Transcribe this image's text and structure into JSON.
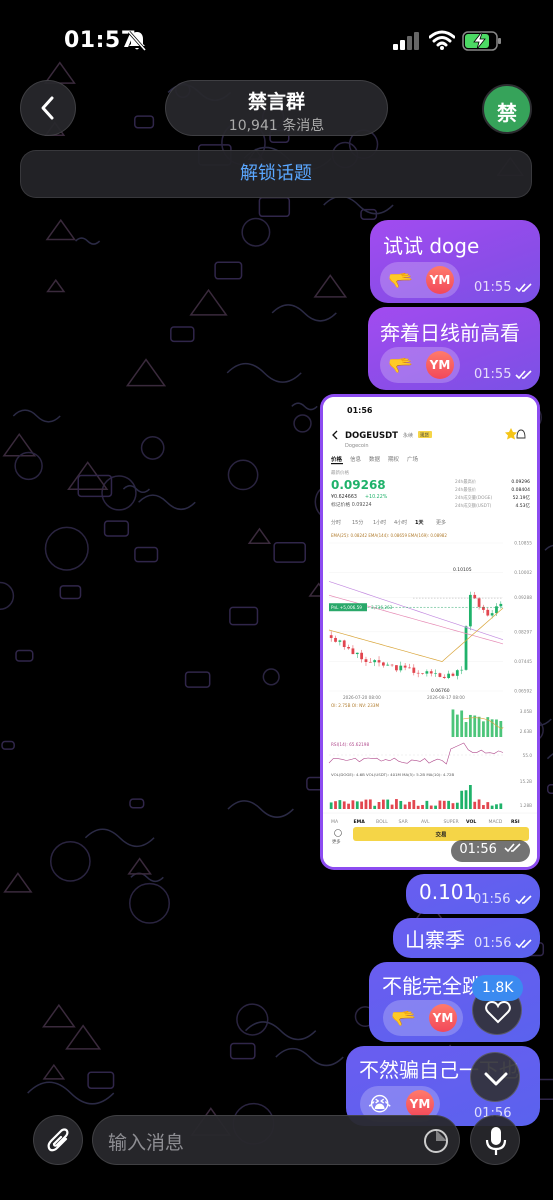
{
  "status_bar": {
    "time": "01:57"
  },
  "header": {
    "title": "禁言群",
    "subtitle": "10,941 条消息",
    "avatar_text": "禁"
  },
  "topic_bar": {
    "label": "解锁话题"
  },
  "colors": {
    "bubble_purple": "#9a4cf0",
    "bubble_blue": "#5f60ee",
    "link_blue": "#5aa7ff",
    "up_green": "#1fb26a",
    "down_red": "#e2464f"
  },
  "messages": [
    {
      "text": "试试 doge",
      "time": "01:55",
      "reaction_emoji": "🫳",
      "reaction_user": "YM"
    },
    {
      "text": "奔着日线前高看",
      "time": "01:55",
      "reaction_emoji": "🫳",
      "reaction_user": "YM"
    },
    {
      "text": "0.101",
      "time": "01:56"
    },
    {
      "text": "山寨季",
      "time": "01:56"
    },
    {
      "text": "不能完全跳完",
      "time": "01:56",
      "reaction_emoji": "🫳",
      "reaction_user": "YM"
    },
    {
      "text": "不然骗自己一下也",
      "time": "01:56",
      "reaction_emoji": "😭",
      "reaction_user": "YM"
    }
  ],
  "screenshot_msg": {
    "time": "01:56",
    "phone_time": "01:56",
    "pair": "DOGEUSDT",
    "perp": "永续",
    "tag": "现货",
    "subtitle": "Dogecoin",
    "tabs": [
      "价格",
      "信息",
      "数据",
      "期权",
      "广场"
    ],
    "last_price_label": "最新价格",
    "price": "0.09268",
    "price_cny": "¥0.624663",
    "change": "+10.22%",
    "mark_price": "标记价格 0.09224",
    "stats": [
      {
        "label": "24h最高价",
        "value": "0.09296"
      },
      {
        "label": "24h最低价",
        "value": "0.08404"
      },
      {
        "label": "24h成交量(DOGE)",
        "value": "52.19亿"
      },
      {
        "label": "24h成交额(USDT)",
        "value": "4.53亿"
      }
    ],
    "intervals": [
      "分时",
      "15分",
      "1小时",
      "4小时",
      "1天",
      "更多"
    ],
    "ema_line": "EMA(25): 0.08242  EMA(144): 0.08659  EMA(169): 0.08982",
    "y_ticks": [
      "0.10855",
      "0.10002",
      "0.09288",
      "0.08297",
      "0.07445",
      "0.06592"
    ],
    "high_label": "0.10105",
    "low_label": "0.06760",
    "pos_label": "PnL +5,006.59",
    "pos_qty": "3,736,263",
    "date_left": "2026-07-20 08:00",
    "date_right": "2026-08-17 08:00",
    "oi_label": "OI: 2.75B  OI: NV: 233M",
    "oi_ticks": [
      "3.05B",
      "2.63B"
    ],
    "rsi_label": "RSI(14): 65.62198",
    "rsi_tick": "55.0",
    "vol_label": "VOL(DOGE): 4.6B  VOL(USDT): 401M  MA(5): 5.2B  MA(10): 4.72B",
    "vol_ticks": [
      "15.2B",
      "1.28B"
    ],
    "indicators": [
      "MA",
      "EMA",
      "BOLL",
      "SAR",
      "AVL",
      "SUPER",
      "VOL",
      "MACD",
      "RSI"
    ],
    "more_label": "更多",
    "trade_label": "交易"
  },
  "floating": {
    "like_count": "1.8K"
  },
  "composer": {
    "placeholder": "输入消息"
  }
}
